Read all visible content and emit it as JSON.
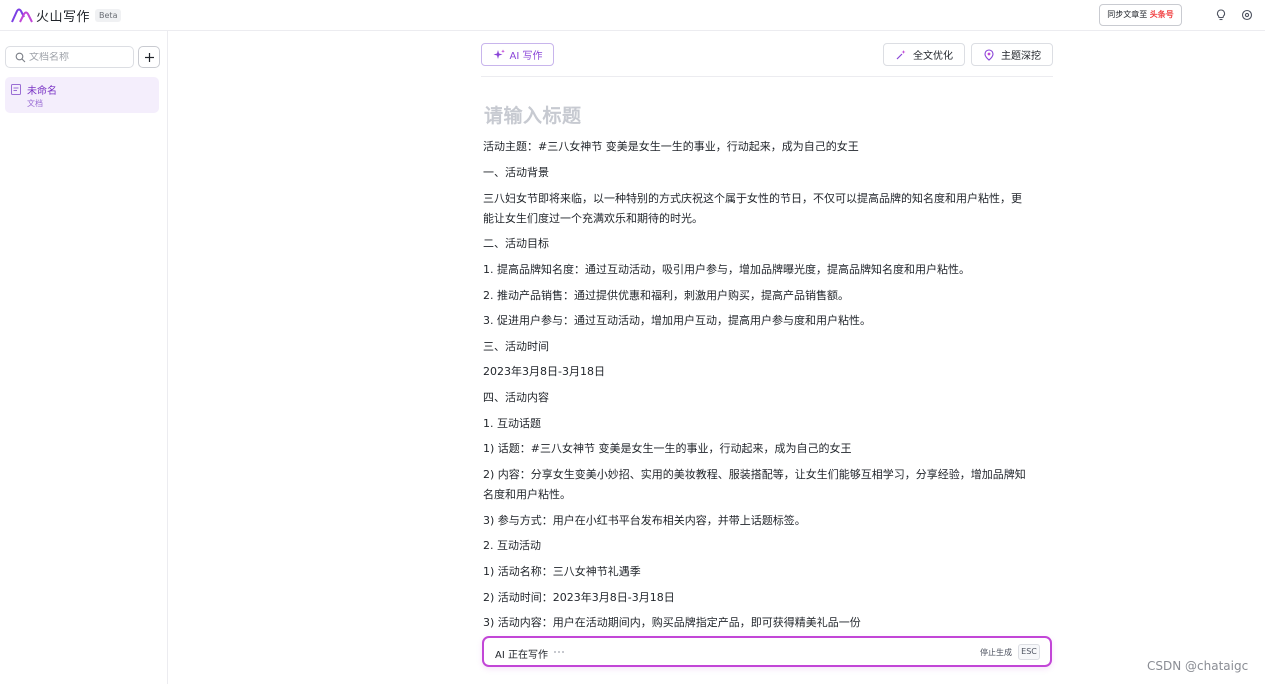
{
  "app": {
    "name": "火山写作",
    "badge": "Beta"
  },
  "topbar": {
    "sync_prefix": "同步文章至",
    "sync_brand": "头条号",
    "brand_color": "#f04142",
    "icons": [
      "bulb-icon",
      "settings-icon"
    ]
  },
  "sidebar": {
    "search_placeholder": "文档名称",
    "add_icon": "plus-icon",
    "documents": [
      {
        "title": "未命名",
        "type": "文档",
        "selected": true
      }
    ]
  },
  "toolbar": {
    "ai_write": "AI 写作",
    "optimize": "全文优化",
    "deep_dive": "主题深挖",
    "accent": "#8a45d8"
  },
  "editor": {
    "title_placeholder": "请输入标题",
    "lines": [
      "活动主题：#三八女神节 变美是女生一生的事业，行动起来，成为自己的女王",
      "一、活动背景",
      "三八妇女节即将来临，以一种特别的方式庆祝这个属于女性的节日，不仅可以提高品牌的知名度和用户粘性，更",
      "能让女生们度过一个充满欢乐和期待的时光。",
      "二、活动目标",
      "1. 提高品牌知名度：通过互动活动，吸引用户参与，增加品牌曝光度，提高品牌知名度和用户粘性。",
      "2. 推动产品销售：通过提供优惠和福利，刺激用户购买，提高产品销售额。",
      "3. 促进用户参与：通过互动活动，增加用户互动，提高用户参与度和用户粘性。",
      "三、活动时间",
      "2023年3月8日-3月18日",
      "四、活动内容",
      "1. 互动话题",
      "1) 话题：#三八女神节 变美是女生一生的事业，行动起来，成为自己的女王",
      "2) 内容：分享女生变美小妙招、实用的美妆教程、服装搭配等，让女生们能够互相学习，分享经验，增加品牌知",
      "名度和用户粘性。",
      "3) 参与方式：用户在小红书平台发布相关内容，并带上话题标签。",
      "2. 互动活动",
      "1) 活动名称：三八女神节礼遇季",
      "2) 活动时间：2023年3月8日-3月18日",
      "3) 活动内容：用户在活动期间内，购买品牌指定产品，即可获得精美礼品一份"
    ]
  },
  "generation": {
    "status": "AI 正在写作",
    "stop_label": "停止生成",
    "stop_key": "ESC"
  },
  "watermark": "CSDN @chataigc"
}
